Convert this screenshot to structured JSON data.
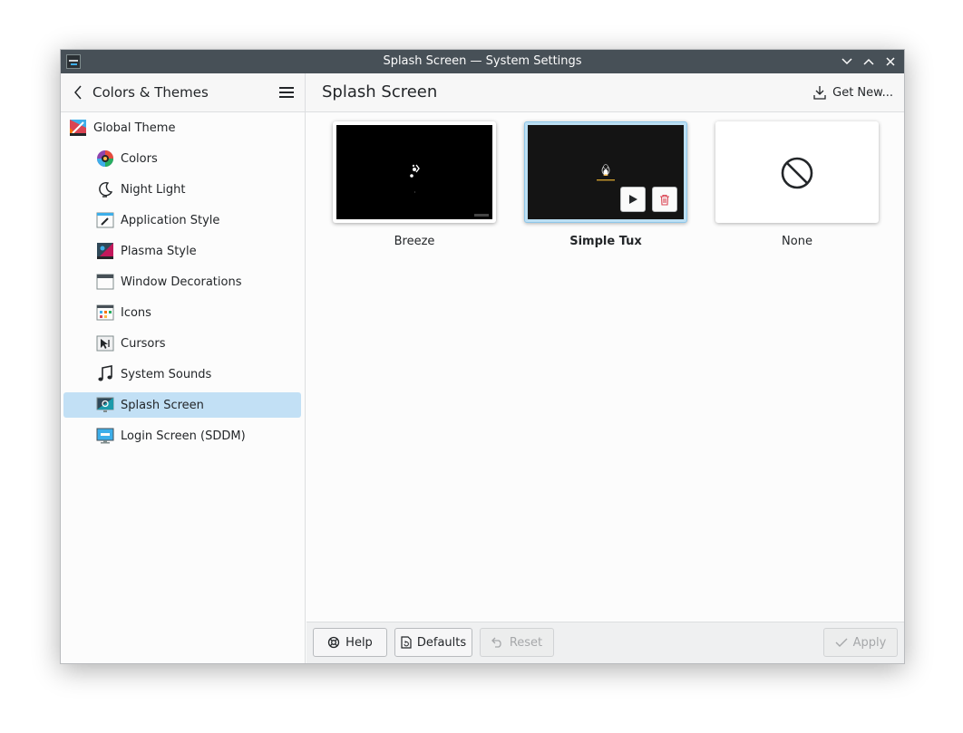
{
  "window": {
    "title": "Splash Screen — System Settings"
  },
  "header": {
    "sidebar_title": "Colors & Themes",
    "page_title": "Splash Screen",
    "get_new_label": "Get New..."
  },
  "sidebar": {
    "items": [
      {
        "label": "Global Theme",
        "icon": "global-theme-icon"
      },
      {
        "label": "Colors",
        "icon": "colors-icon"
      },
      {
        "label": "Night Light",
        "icon": "night-light-icon"
      },
      {
        "label": "Application Style",
        "icon": "application-style-icon"
      },
      {
        "label": "Plasma Style",
        "icon": "plasma-style-icon"
      },
      {
        "label": "Window Decorations",
        "icon": "window-decorations-icon"
      },
      {
        "label": "Icons",
        "icon": "icons-icon"
      },
      {
        "label": "Cursors",
        "icon": "cursors-icon"
      },
      {
        "label": "System Sounds",
        "icon": "system-sounds-icon"
      },
      {
        "label": "Splash Screen",
        "icon": "splash-screen-icon",
        "selected": true
      },
      {
        "label": "Login Screen (SDDM)",
        "icon": "login-screen-icon"
      }
    ]
  },
  "themes": [
    {
      "name": "Breeze"
    },
    {
      "name": "Simple Tux",
      "selected": true
    },
    {
      "name": "None"
    }
  ],
  "footer": {
    "help_label": "Help",
    "defaults_label": "Defaults",
    "reset_label": "Reset",
    "apply_label": "Apply"
  },
  "colors": {
    "titlebar": "#475057",
    "selection": "#c2e0f5",
    "accent": "#3daee9",
    "delete": "#da4453"
  }
}
